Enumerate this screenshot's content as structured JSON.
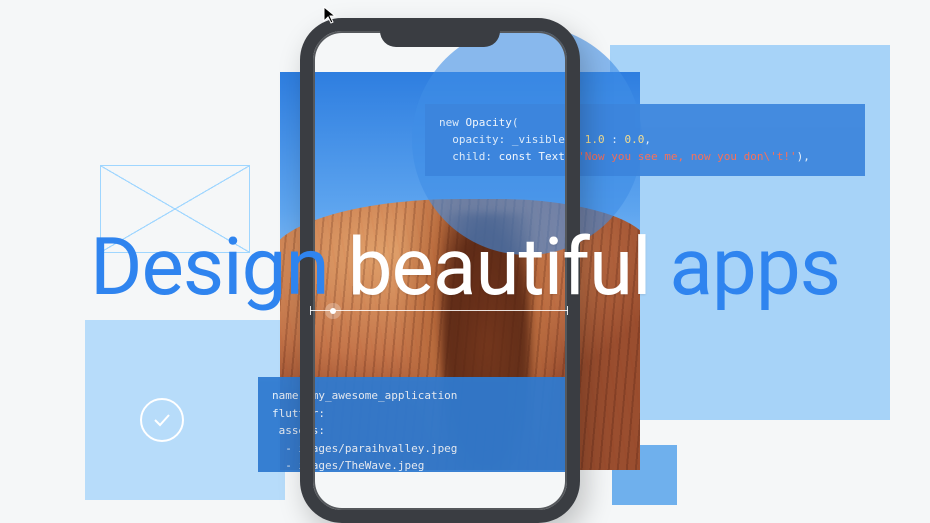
{
  "headline": {
    "word1": "Design",
    "word2": "beautiful",
    "word3": "apps"
  },
  "code_top": {
    "line1a": "new ",
    "line1b": "Opacity",
    "line1c": "(",
    "line2a": "  opacity: _visible ? ",
    "line2b": "1.0",
    "line2c": " : ",
    "line2d": "0.0",
    "line2e": ",",
    "line3a": "  child: ",
    "line3b": "const ",
    "line3c": "Text",
    "line3d": "( ",
    "line3e": "'Now you see me, now you don\\'t!'",
    "line3f": "),"
  },
  "code_bot": {
    "line1": "name: my_awesome_application",
    "line2": "flutter:",
    "line3": " assets:",
    "line4": "  - images/paraihvalley.jpeg",
    "line5": "  - images/TheWave.jpeg"
  },
  "icons": {
    "check": "check"
  }
}
